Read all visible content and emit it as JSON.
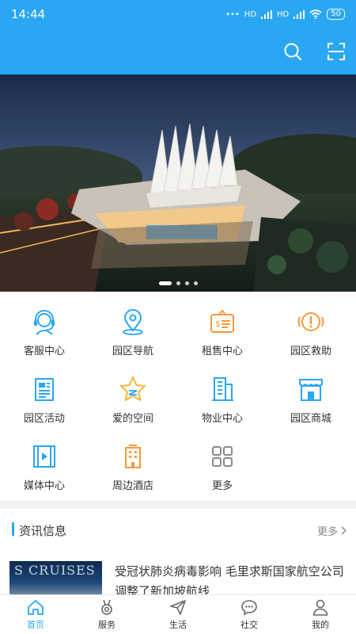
{
  "status_bar": {
    "time": "14:44",
    "network_1": "HD",
    "network_2": "HD",
    "battery": "50"
  },
  "header": {
    "search_icon": "search-icon",
    "scan_icon": "scan-icon"
  },
  "banner": {
    "slide_count": 4,
    "active_index": 0
  },
  "accent_color": "#2aa7f3",
  "grid": [
    {
      "label": "客服中心",
      "icon": "headset-icon",
      "color": "#2aa7f3"
    },
    {
      "label": "园区导航",
      "icon": "location-pin-icon",
      "color": "#2aa7f3"
    },
    {
      "label": "租售中心",
      "icon": "price-tag-icon",
      "color": "#f39a3b"
    },
    {
      "label": "园区救助",
      "icon": "alert-icon",
      "color": "#f39a3b"
    },
    {
      "label": "园区活动",
      "icon": "newspaper-icon",
      "color": "#2aa7f3"
    },
    {
      "label": "爱的空间",
      "icon": "star-icon",
      "color": "#f3b83b"
    },
    {
      "label": "物业中心",
      "icon": "building-icon",
      "color": "#2aa7f3"
    },
    {
      "label": "园区商城",
      "icon": "shop-icon",
      "color": "#2aa7f3"
    },
    {
      "label": "媒体中心",
      "icon": "film-icon",
      "color": "#2aa7f3"
    },
    {
      "label": "周边酒店",
      "icon": "hotel-icon",
      "color": "#f39a3b"
    },
    {
      "label": "更多",
      "icon": "more-grid-icon",
      "color": "#8a8a8a"
    }
  ],
  "news": {
    "section_title": "资讯信息",
    "more_label": "更多",
    "items": [
      {
        "title": "受冠状肺炎病毒影响 毛里求斯国家航空公司调整了新加坡航线",
        "thumb_text": "S CRUISES"
      }
    ]
  },
  "tabs": [
    {
      "label": "首页",
      "icon": "home-icon",
      "active": true
    },
    {
      "label": "服务",
      "icon": "medal-icon",
      "active": false
    },
    {
      "label": "生活",
      "icon": "paper-plane-icon",
      "active": false
    },
    {
      "label": "社交",
      "icon": "chat-bubble-icon",
      "active": false
    },
    {
      "label": "我的",
      "icon": "user-icon",
      "active": false
    }
  ]
}
